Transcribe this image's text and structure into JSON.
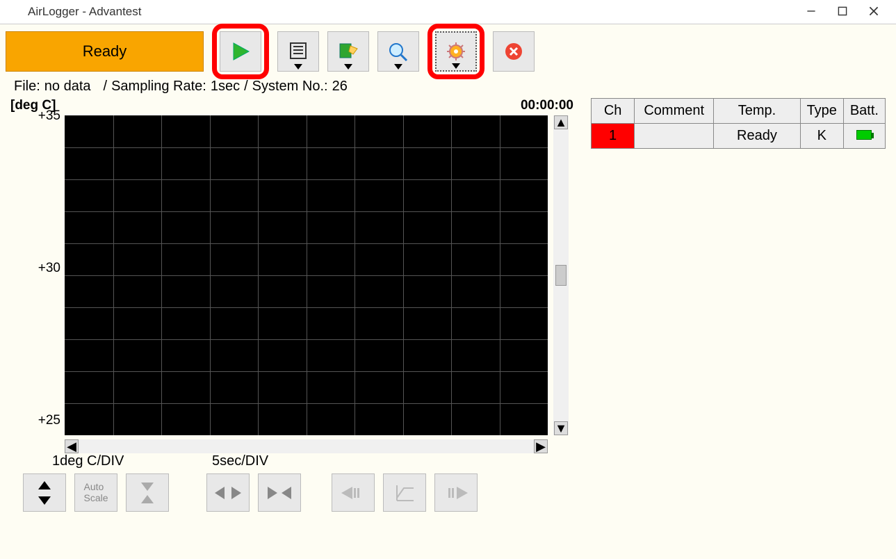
{
  "window": {
    "title": "AirLogger - Advantest"
  },
  "toolbar": {
    "ready_label": "Ready"
  },
  "status": {
    "file_prefix": "File:",
    "file_value": "no data",
    "sep1": "/",
    "rate_prefix": "Sampling Rate:",
    "rate_value": "1sec",
    "sep2": "/",
    "sysno_prefix": "System No.:",
    "sysno_value": "26"
  },
  "chart": {
    "unit_label": "[deg C]",
    "timer": "00:00:00",
    "y_ticks": [
      "+35",
      "+30",
      "+25"
    ],
    "y_div_label": "1deg C/DIV",
    "x_div_label": "5sec/DIV"
  },
  "bottom_buttons": {
    "autoscale": "Auto\nScale"
  },
  "table": {
    "headers": [
      "Ch",
      "Comment",
      "Temp.",
      "Type",
      "Batt."
    ],
    "rows": [
      {
        "ch": "1",
        "comment": "",
        "temp": "Ready",
        "type": "K",
        "batt": "ok"
      }
    ]
  },
  "chart_data": {
    "type": "line",
    "title": "",
    "xlabel": "time",
    "ylabel": "deg C",
    "ylim": [
      25,
      35
    ],
    "x_div_sec": 5,
    "y_div_deg": 1,
    "series": []
  }
}
